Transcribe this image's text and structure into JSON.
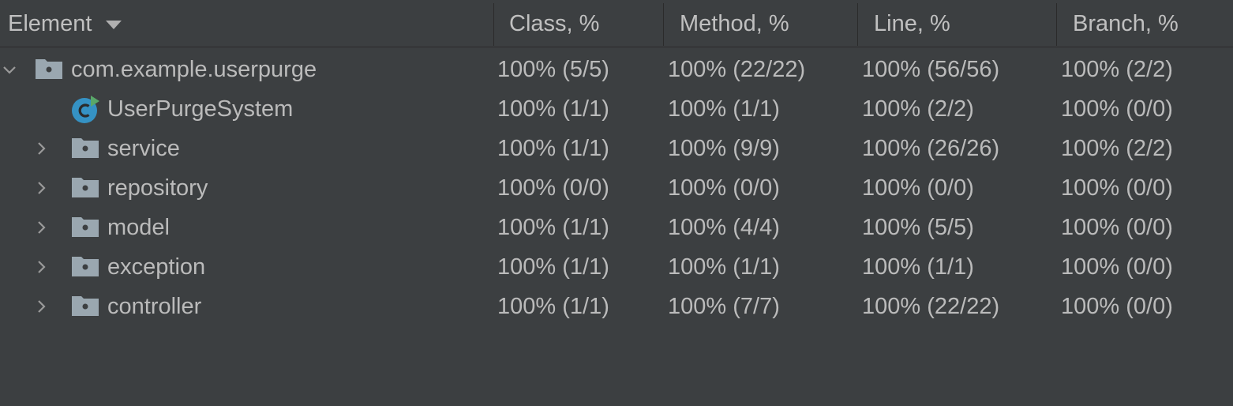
{
  "columns": {
    "element": "Element",
    "class": "Class, %",
    "method": "Method, %",
    "line": "Line, %",
    "branch": "Branch, %"
  },
  "rows": [
    {
      "name": "com.example.userpurge",
      "type": "package",
      "expanded": true,
      "class": "100% (5/5)",
      "method": "100% (22/22)",
      "line": "100% (56/56)",
      "branch": "100% (2/2)"
    },
    {
      "name": "UserPurgeSystem",
      "type": "class",
      "expanded": false,
      "class": "100% (1/1)",
      "method": "100% (1/1)",
      "line": "100% (2/2)",
      "branch": "100% (0/0)"
    },
    {
      "name": "service",
      "type": "package",
      "expanded": false,
      "class": "100% (1/1)",
      "method": "100% (9/9)",
      "line": "100% (26/26)",
      "branch": "100% (2/2)"
    },
    {
      "name": "repository",
      "type": "package",
      "expanded": false,
      "class": "100% (0/0)",
      "method": "100% (0/0)",
      "line": "100% (0/0)",
      "branch": "100% (0/0)"
    },
    {
      "name": "model",
      "type": "package",
      "expanded": false,
      "class": "100% (1/1)",
      "method": "100% (4/4)",
      "line": "100% (5/5)",
      "branch": "100% (0/0)"
    },
    {
      "name": "exception",
      "type": "package",
      "expanded": false,
      "class": "100% (1/1)",
      "method": "100% (1/1)",
      "line": "100% (1/1)",
      "branch": "100% (0/0)"
    },
    {
      "name": "controller",
      "type": "package",
      "expanded": false,
      "class": "100% (1/1)",
      "method": "100% (7/7)",
      "line": "100% (22/22)",
      "branch": "100% (0/0)"
    }
  ],
  "colors": {
    "background": "#3c3f41",
    "text": "#bbbbbb",
    "folder_icon": "#9aa7b0",
    "class_icon": "#3592c4",
    "run_badge": "#59a869"
  }
}
